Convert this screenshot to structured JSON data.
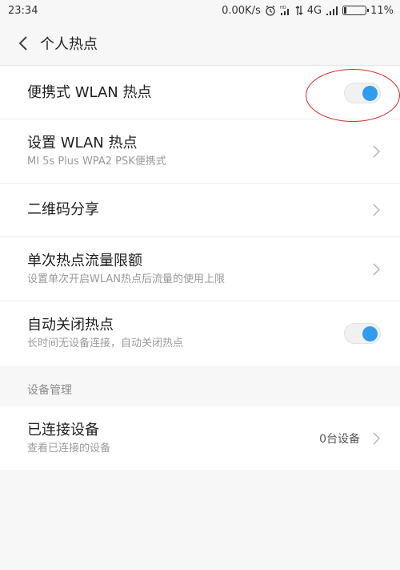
{
  "status_bar": {
    "time": "23:34",
    "speed": "0.00K/s",
    "network": "4G",
    "battery": "11%",
    "battery_level": 0.11
  },
  "header": {
    "title": "个人热点"
  },
  "settings": {
    "hotspot": {
      "title": "便携式 WLAN 热点",
      "enabled": true
    },
    "setup": {
      "title": "设置 WLAN 热点",
      "subtitle": "MI 5s Plus WPA2 PSK便携式"
    },
    "qrcode": {
      "title": "二维码分享"
    },
    "limit": {
      "title": "单次热点流量限额",
      "subtitle": "设置单次开启WLAN热点后流量的使用上限"
    },
    "autoclose": {
      "title": "自动关闭热点",
      "subtitle": "长时间无设备连接，自动关闭热点",
      "enabled": true
    }
  },
  "device_section": {
    "label": "设备管理",
    "connected": {
      "title": "已连接设备",
      "subtitle": "查看已连接的设备",
      "value": "0台设备"
    }
  },
  "colors": {
    "toggle_on": "#2f9cf0",
    "highlight": "#d62b2b"
  }
}
